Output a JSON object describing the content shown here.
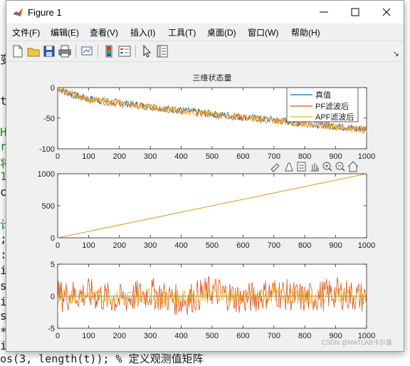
{
  "background_code": {
    "lines": [
      {
        "text": "H",
        "color": "#2a8a2a"
      },
      {
        "text": "r",
        "color": "#2a8a2a"
      },
      {
        "text": "将",
        "color": "#2a8a2a"
      },
      {
        "text": "1",
        "color": "#2a8a2a"
      },
      {
        "text": "c",
        "color": "#1c1c1c"
      },
      {
        "text": "计",
        "color": "#2a8a2a"
      },
      {
        "text": ";",
        "color": "#1c1c1c"
      },
      {
        "text": ":",
        "color": "#1c1c1c"
      },
      {
        "text": "i",
        "color": "#1c1c1c"
      },
      {
        "text": "s",
        "color": "#1c1c1c"
      },
      {
        "text": "i",
        "color": "#1c1c1c"
      },
      {
        "text": "s",
        "color": "#1c1c1c"
      },
      {
        "text": "*",
        "color": "#1c1c1c"
      },
      {
        "text": "i",
        "color": "#1c1c1c"
      }
    ],
    "bottom_line": "os(3, length(t)); % 定义观测值矩阵",
    "left_fragment_1": "变",
    "left_fragment_2": "ti"
  },
  "window": {
    "title": "Figure 1"
  },
  "menu": [
    "文件(F)",
    "编辑(E)",
    "查看(V)",
    "插入(I)",
    "工具(T)",
    "桌面(D)",
    "窗口(W)",
    "帮助(H)"
  ],
  "toolbar_icons": [
    "new-figure-icon",
    "open-file-icon",
    "save-icon",
    "print-icon",
    "link-plot-icon",
    "insert-colorbar-icon",
    "insert-legend-icon",
    "pointer-icon",
    "property-inspector-icon"
  ],
  "axes_toolbar_icons": [
    "brush-icon",
    "data-tips-icon",
    "rotate-icon",
    "pan-icon",
    "zoom-in-icon",
    "zoom-out-icon",
    "home-icon"
  ],
  "watermark": "CSDN @MATLAB卡尔曼",
  "chart_data": [
    {
      "type": "line",
      "title": "三维状态量",
      "xlim": [
        0,
        1000
      ],
      "ylim": [
        -100,
        0
      ],
      "xticks": [
        0,
        100,
        200,
        300,
        400,
        500,
        600,
        700,
        800,
        900,
        1000
      ],
      "yticks": [
        0,
        -50,
        -100
      ],
      "legend": {
        "position": "top-right"
      },
      "series": [
        {
          "name": "真值",
          "color": "#0072BD",
          "x": [
            0,
            50,
            100,
            200,
            300,
            400,
            500,
            600,
            700,
            800,
            900,
            1000
          ],
          "y": [
            0,
            -12,
            -18,
            -25,
            -31,
            -37,
            -43,
            -48,
            -53,
            -58,
            -63,
            -68
          ]
        },
        {
          "name": "PF滤波后",
          "color": "#D95319",
          "x": [
            0,
            50,
            100,
            200,
            300,
            400,
            500,
            600,
            700,
            800,
            900,
            1000
          ],
          "y": [
            0,
            -13,
            -19,
            -26,
            -32,
            -38,
            -44,
            -49,
            -54,
            -59,
            -64,
            -69
          ]
        },
        {
          "name": "APF滤波后",
          "color": "#EDB120",
          "x": [
            0,
            50,
            100,
            200,
            300,
            400,
            500,
            600,
            700,
            800,
            900,
            1000
          ],
          "y": [
            0,
            -12,
            -19,
            -25,
            -32,
            -38,
            -43,
            -48,
            -54,
            -59,
            -64,
            -69
          ]
        }
      ]
    },
    {
      "type": "line",
      "xlim": [
        0,
        1000
      ],
      "ylim": [
        0,
        1000
      ],
      "xticks": [
        0,
        100,
        200,
        300,
        400,
        500,
        600,
        700,
        800,
        900,
        1000
      ],
      "yticks": [
        1000,
        500,
        0
      ],
      "series": [
        {
          "color": "#0072BD",
          "x": [
            0,
            1000
          ],
          "y": [
            0,
            1000
          ]
        },
        {
          "color": "#D95319",
          "x": [
            0,
            1000
          ],
          "y": [
            0,
            1000
          ]
        },
        {
          "color": "#EDB120",
          "x": [
            0,
            1000
          ],
          "y": [
            0,
            1000
          ]
        }
      ]
    },
    {
      "type": "line",
      "xlim": [
        0,
        1000
      ],
      "ylim": [
        -5,
        5
      ],
      "xticks": [
        0,
        100,
        200,
        300,
        400,
        500,
        600,
        700,
        800,
        900,
        1000
      ],
      "yticks": [
        5,
        0,
        -5
      ],
      "series": [
        {
          "color": "#0072BD",
          "x": [
            0,
            1000
          ],
          "y": [
            0,
            0
          ]
        },
        {
          "color": "#D95319",
          "x": [
            0,
            100,
            200,
            300,
            400,
            500,
            600,
            700,
            800,
            900,
            1000
          ],
          "y": [
            0,
            1.5,
            -2.5,
            2,
            -3,
            3.5,
            -2,
            2.5,
            -1.5,
            2,
            -1
          ]
        },
        {
          "color": "#EDB120",
          "x": [
            0,
            100,
            200,
            300,
            400,
            500,
            600,
            700,
            800,
            900,
            1000
          ],
          "y": [
            0,
            0.8,
            -1.2,
            1,
            -1.4,
            1.6,
            -1,
            1.2,
            -0.8,
            1,
            -0.5
          ]
        }
      ]
    }
  ]
}
